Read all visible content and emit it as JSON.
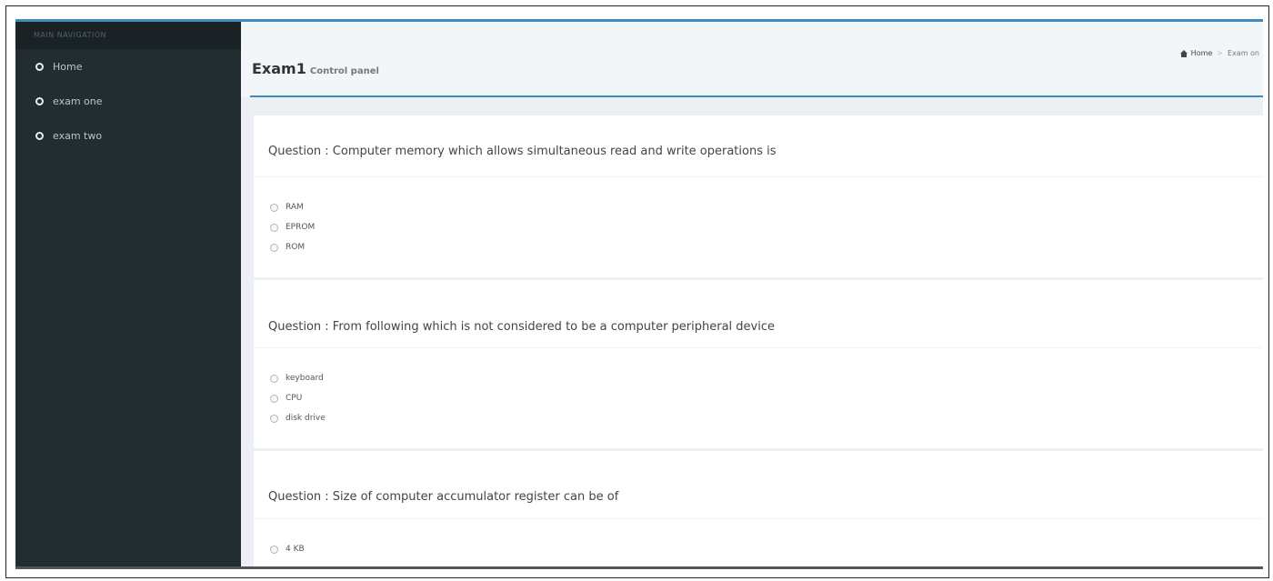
{
  "sidebar": {
    "header": "MAIN NAVIGATION",
    "items": [
      {
        "label": "Home"
      },
      {
        "label": "exam one"
      },
      {
        "label": "exam two"
      }
    ]
  },
  "header": {
    "title": "Exam1",
    "subtitle": "Control panel",
    "breadcrumb": {
      "home": "Home",
      "current": "Exam on"
    }
  },
  "questions": [
    {
      "text": "Question : Computer memory which allows simultaneous read and write operations is",
      "options": [
        "RAM",
        "EPROM",
        "ROM"
      ]
    },
    {
      "text": "Question : From following which is not considered to be a computer peripheral device",
      "options": [
        "keyboard",
        "CPU",
        "disk drive"
      ]
    },
    {
      "text": "Question : Size of computer accumulator register can be of",
      "options": [
        "4 KB"
      ]
    }
  ],
  "colors": {
    "sidebar": "#222d32",
    "accent": "#3c8dbc",
    "background": "#ecf0f5"
  }
}
